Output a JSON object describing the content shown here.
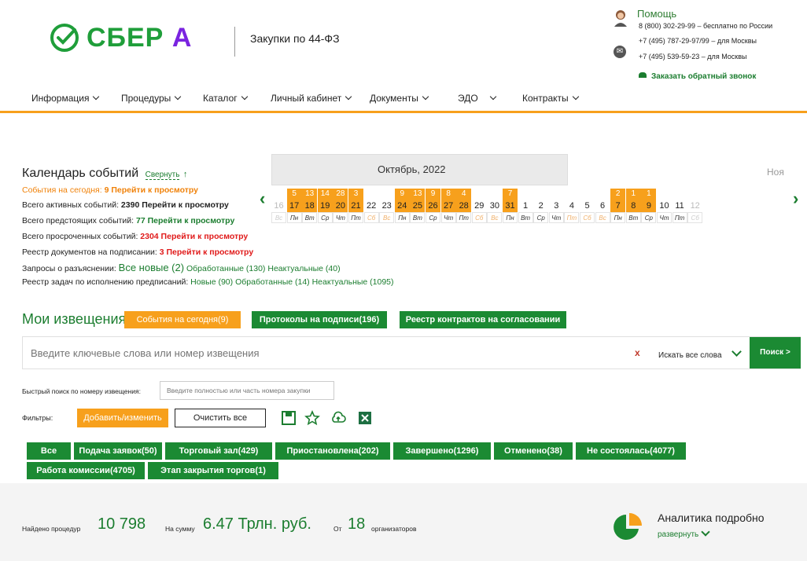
{
  "header": {
    "logo_text": "СБЕР",
    "logo_accent": "А",
    "site_title": "Закупки по 44-ФЗ",
    "help": {
      "title": "Помощь",
      "lines": [
        "8 (800) 302-29-99 – бесплатно по России",
        "+7 (495) 787-29-97/99 – для Москвы",
        "+7 (495) 539-59-23 – для Москвы"
      ],
      "callback": "Заказать обратный звонок"
    }
  },
  "nav": [
    {
      "label": "Информация"
    },
    {
      "label": "Процедуры"
    },
    {
      "label": "Каталог"
    },
    {
      "label": "Личный кабинет"
    },
    {
      "label": "Документы"
    },
    {
      "label": "ЭДО"
    },
    {
      "label": "Контракты"
    }
  ],
  "calendar_info": {
    "title": "Календарь событий",
    "collapse": "Свернуть",
    "arrow": "↑",
    "today_label": "События на сегодня:",
    "today_value": "9 Перейти к просмотру",
    "active_label": "Всего активных событий:",
    "active_value": "2390 Перейти к просмотру",
    "upcoming_label": "Всего предстоящих событий:",
    "upcoming_value": "77 Перейти к просмотру",
    "overdue_label": "Всего просроченных событий:",
    "overdue_value": "2304 Перейти к просмотру",
    "sign_label": "Реестр документов на подписании:",
    "sign_value": "3 Перейти к просмотру",
    "req_label": "Запросы о разъяснении:",
    "req_new": "Все новые (2)",
    "req_processed": "Обработанные (130)",
    "req_irrelevant": "Неактуальные (40)",
    "tasks_label": "Реестр задач по исполнению предписаний:",
    "tasks_new": "Новые (90)",
    "tasks_processed": "Обработанные (14)",
    "tasks_irrelevant": "Неактуальные (1095)"
  },
  "calendar": {
    "month": "Октябрь, 2022",
    "next_month": "Ноя",
    "days": [
      {
        "cnt": "",
        "day": "16",
        "dow": "Вс",
        "on": false,
        "dim": true,
        "we": true
      },
      {
        "cnt": "5",
        "day": "17",
        "dow": "Пн",
        "on": true,
        "dim": false,
        "we": false
      },
      {
        "cnt": "13",
        "day": "18",
        "dow": "Вт",
        "on": true,
        "dim": false,
        "we": false
      },
      {
        "cnt": "14",
        "day": "19",
        "dow": "Ср",
        "on": true,
        "dim": false,
        "we": false
      },
      {
        "cnt": "28",
        "day": "20",
        "dow": "Чт",
        "on": true,
        "dim": false,
        "we": false
      },
      {
        "cnt": "3",
        "day": "21",
        "dow": "Пт",
        "on": true,
        "dim": false,
        "we": false
      },
      {
        "cnt": "",
        "day": "22",
        "dow": "Сб",
        "on": false,
        "dim": false,
        "we": true
      },
      {
        "cnt": "",
        "day": "23",
        "dow": "Вс",
        "on": false,
        "dim": false,
        "we": true
      },
      {
        "cnt": "9",
        "day": "24",
        "dow": "Пн",
        "on": true,
        "dim": false,
        "we": false
      },
      {
        "cnt": "13",
        "day": "25",
        "dow": "Вт",
        "on": true,
        "dim": false,
        "we": false
      },
      {
        "cnt": "9",
        "day": "26",
        "dow": "Ср",
        "on": true,
        "dim": false,
        "we": false
      },
      {
        "cnt": "8",
        "day": "27",
        "dow": "Чт",
        "on": true,
        "dim": false,
        "we": false
      },
      {
        "cnt": "4",
        "day": "28",
        "dow": "Пт",
        "on": true,
        "dim": false,
        "we": false
      },
      {
        "cnt": "",
        "day": "29",
        "dow": "Сб",
        "on": false,
        "dim": false,
        "we": true
      },
      {
        "cnt": "",
        "day": "30",
        "dow": "Вс",
        "on": false,
        "dim": false,
        "we": true
      },
      {
        "cnt": "7",
        "day": "31",
        "dow": "Пн",
        "on": true,
        "dim": false,
        "we": false
      },
      {
        "cnt": "",
        "day": "1",
        "dow": "Вт",
        "on": false,
        "dim": false,
        "we": false
      },
      {
        "cnt": "",
        "day": "2",
        "dow": "Ср",
        "on": false,
        "dim": false,
        "we": false
      },
      {
        "cnt": "",
        "day": "3",
        "dow": "Чт",
        "on": false,
        "dim": false,
        "we": false
      },
      {
        "cnt": "",
        "day": "4",
        "dow": "Пт",
        "on": false,
        "dim": false,
        "we": true
      },
      {
        "cnt": "",
        "day": "5",
        "dow": "Сб",
        "on": false,
        "dim": false,
        "we": true
      },
      {
        "cnt": "",
        "day": "6",
        "dow": "Вс",
        "on": false,
        "dim": false,
        "we": true
      },
      {
        "cnt": "2",
        "day": "7",
        "dow": "Пн",
        "on": true,
        "dim": false,
        "we": false
      },
      {
        "cnt": "1",
        "day": "8",
        "dow": "Вт",
        "on": true,
        "dim": false,
        "we": false
      },
      {
        "cnt": "1",
        "day": "9",
        "dow": "Ср",
        "on": true,
        "dim": false,
        "we": false
      },
      {
        "cnt": "",
        "day": "10",
        "dow": "Чт",
        "on": false,
        "dim": false,
        "we": false
      },
      {
        "cnt": "",
        "day": "11",
        "dow": "Пт",
        "on": false,
        "dim": false,
        "we": false
      },
      {
        "cnt": "",
        "day": "12",
        "dow": "Сб",
        "on": false,
        "dim": true,
        "we": true
      }
    ]
  },
  "notices": {
    "title": "Мои извещения",
    "btn_today": "События на сегодня(9)",
    "btn_protocols": "Протоколы на подписи(196)",
    "btn_contracts": "Реестр контрактов на согласовании"
  },
  "search": {
    "placeholder": "Введите ключевые слова или номер извещения",
    "clear": "x",
    "mode": "Искать все слова",
    "button": "Поиск >"
  },
  "quick": {
    "label": "Быстрый поиск по номеру извещения:",
    "placeholder": "Введите полностью или часть номера закупки"
  },
  "filters": {
    "label": "Фильтры:",
    "add": "Добавить/изменить",
    "clear": "Очистить все"
  },
  "status_filters": [
    "Все",
    "Подача заявок(50)",
    "Торговый зал(429)",
    "Приостановлена(202)",
    "Завершено(1296)",
    "Отменено(38)",
    "Не состоялась(4077)",
    "Работа комиссии(4705)",
    "Этап закрытия торгов(1)"
  ],
  "stats": {
    "found_label": "Найдено процедур",
    "found_value": "10 798",
    "sum_label": "На сумму",
    "sum_value": "6.47 Трлн. руб.",
    "from_label": "От",
    "from_value": "18",
    "org_label": "организаторов",
    "analytics_title": "Аналитика подробно",
    "analytics_expand": "развернуть"
  },
  "colors": {
    "brand_green": "#1b8a33",
    "accent_orange": "#f7a01c",
    "logo_purple": "#7a24e0"
  }
}
